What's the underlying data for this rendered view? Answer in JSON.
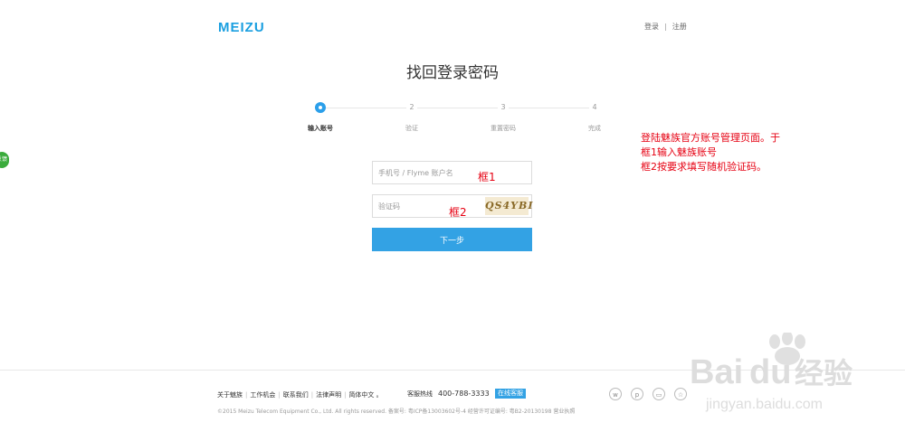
{
  "header": {
    "logo_text": "MEIZU",
    "login": "登录",
    "separator": "|",
    "register": "注册"
  },
  "page": {
    "title": "找回登录密码"
  },
  "steps": [
    {
      "number": "",
      "label": "输入账号",
      "active": true
    },
    {
      "number": "2",
      "label": "验证",
      "active": false
    },
    {
      "number": "3",
      "label": "重置密码",
      "active": false
    },
    {
      "number": "4",
      "label": "完成",
      "active": false
    }
  ],
  "form": {
    "account_placeholder": "手机号 / Flyme 账户名",
    "captcha_placeholder": "验证码",
    "captcha_image_text": "QS4YBI",
    "next_label": "下一步"
  },
  "annotations": {
    "box1": "框1",
    "box2": "框2",
    "note_lines": [
      "登陆魅族官方账号管理页面。于",
      "框1输入魅族账号",
      "框2按要求填写随机验证码。"
    ]
  },
  "side_tab": {
    "text": "反馈"
  },
  "footer": {
    "links": [
      "关于魅族",
      "工作机会",
      "联系我们",
      "法律声明",
      "简体中文 。"
    ],
    "hotline_label": "客服热线",
    "hotline_number": "400-788-3333",
    "online_service": "在线客服",
    "copyright": "©2015 Meizu Telecom Equipment Co., Ltd. All rights reserved.  备案号: 粤ICP备13003602号-4  经营许可证编号: 粤B2-20130198  营业执照",
    "social_icons": [
      "weibo-icon",
      "chat-icon",
      "message-icon",
      "star-icon"
    ]
  },
  "watermark": {
    "brand": "Baidu",
    "suffix": "经验",
    "url": "jingyan.baidu.com"
  },
  "colors": {
    "accent": "#33a2e4",
    "logo": "#1a9fe0",
    "annotation": "#e60012"
  }
}
